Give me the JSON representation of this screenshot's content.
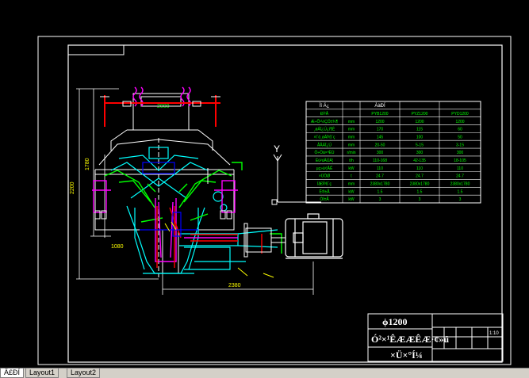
{
  "drawing": {
    "title_line1": "ϕ1200",
    "title_line2": "Ó²×¹ÊÆÆÊÆ·¢»ú",
    "title_line3": "×Ü×°Í¼",
    "scale": "1:10"
  },
  "dimensions": {
    "overall_height": "2200",
    "main_height": "1780",
    "main_width": "2380",
    "base_note": "1080",
    "upper_width": "2000"
  },
  "ucs": {
    "y_label": "Y"
  },
  "spec_table": {
    "header": [
      "Ïî Ä¿",
      "",
      "ÀàÐÍ",
      "",
      ""
    ],
    "rows": [
      [
        "ÐÍºÅ",
        "",
        "PYB1200",
        "PYZ1200",
        "PYD1200"
      ],
      [
        "Æ÷Õ¹½ÇÖ±¾¶",
        "mm",
        "1200",
        "1200",
        "1200"
      ],
      [
        "¸øÁÏ¿Ú¿í¶È",
        "mm",
        "170",
        "115",
        "60"
      ],
      [
        "×î´ó¸øÁÏ³ß´ç",
        "mm",
        "145",
        "100",
        "50"
      ],
      [
        "ÅÅÁÏ¿Ú",
        "mm",
        "20-50",
        "5-15",
        "3-15"
      ],
      [
        "Ö÷Öá×ªËÙ",
        "r/min",
        "300",
        "300",
        "300"
      ],
      [
        "Éú²úÄÜÁ¦",
        "t/h",
        "110-168",
        "42-135",
        "18-105"
      ],
      [
        "µç»ú¹¦ÂÊ",
        "kW",
        "110",
        "110",
        "110"
      ],
      [
        "×ÜÖØ",
        "t",
        "24.7",
        "24.7",
        "24.7"
      ],
      [
        "ÍâÐÎ³ß´ç",
        "mm",
        "2380x1780",
        "2380x1780",
        "2380x1780"
      ],
      [
        "Ë®±Ã",
        "kW",
        "1.5",
        "1.5",
        "1.5"
      ],
      [
        "ÓÍ±Ã",
        "kW",
        "3",
        "3",
        "3"
      ]
    ]
  },
  "layout_tabs": [
    {
      "label": "Ä£ÐÍ",
      "active": true
    },
    {
      "label": "Layout1",
      "active": false
    },
    {
      "label": "Layout2",
      "active": false
    }
  ],
  "colors": {
    "background": "#000000",
    "frame": "#ffffff",
    "table": "#00ff00",
    "cyan": "#00ffff",
    "magenta": "#ff00ff",
    "red": "#ff0000",
    "yellow": "#ffff00",
    "blue": "#0000ff"
  }
}
